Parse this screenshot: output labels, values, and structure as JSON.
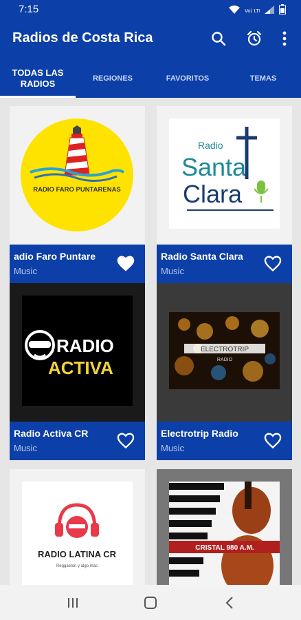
{
  "status_bar": {
    "time": "7:15",
    "icons": [
      "wifi-icon",
      "volte-lte-icon",
      "signal-icon",
      "battery-icon"
    ],
    "volte_label": "Vo) LTE"
  },
  "app_bar": {
    "title": "Radios de Costa Rica",
    "actions": [
      "search-icon",
      "alarm-icon",
      "more-vert-icon"
    ]
  },
  "tabs": [
    {
      "label": "TODAS LAS RADIOS",
      "line1": "TODAS LAS",
      "line2": "RADIOS",
      "selected": true
    },
    {
      "label": "REGIONES",
      "selected": false
    },
    {
      "label": "FAVORITOS",
      "selected": false
    },
    {
      "label": "TEMAS",
      "selected": false
    }
  ],
  "stations": [
    {
      "name": "Radio Faro Puntarenas",
      "name_visible": "adio Faro Puntare",
      "genre": "Music",
      "favorite": true,
      "logo_text": "RADIO FARO PUNTARENAS"
    },
    {
      "name": "Radio Santa Clara",
      "genre": "Music",
      "favorite": false,
      "logo_line1": "Radio",
      "logo_line2": "Santa",
      "logo_line3": "Clara"
    },
    {
      "name": "Radio Activa CR",
      "genre": "Music",
      "favorite": false,
      "logo_line1": "RADIO",
      "logo_line2": "ACTIVA"
    },
    {
      "name": "Electrotrip Radio",
      "genre": "Music",
      "favorite": false,
      "logo_line1": "ELECTROTRIP",
      "logo_line2": "RADIO"
    },
    {
      "name": "Radio Latina CR",
      "genre": "",
      "favorite": false,
      "logo_line1": "RADIO LATINA CR",
      "logo_line2": "Reggaeton y algo más"
    },
    {
      "name": "Cristal 980 A.M.",
      "genre": "",
      "favorite": false,
      "logo_text": "CRISTAL 980 A.M."
    }
  ],
  "colors": {
    "primary": "#0c3fa7",
    "background": "#e6e6e6",
    "card_info": "#0c3fa7",
    "genre_text": "#b8c8ee",
    "navbar": "#f2f2f2"
  },
  "nav_bar": {
    "buttons": [
      "recent-apps-icon",
      "home-icon",
      "back-icon"
    ]
  }
}
